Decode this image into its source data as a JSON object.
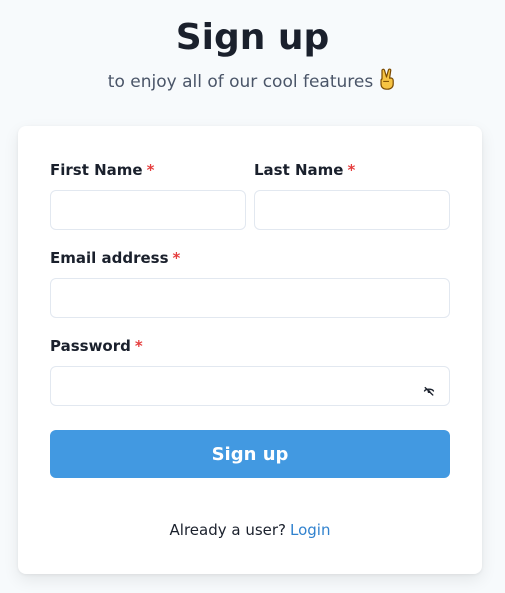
{
  "header": {
    "title": "Sign up",
    "subtitle": "to enjoy all of our cool features",
    "emoji": "✌️"
  },
  "form": {
    "required_marker": "*",
    "first_name": {
      "label": "First Name",
      "value": ""
    },
    "last_name": {
      "label": "Last Name",
      "value": ""
    },
    "email": {
      "label": "Email address",
      "value": ""
    },
    "password": {
      "label": "Password",
      "value": "",
      "toggle_icon": "eye-slash-icon"
    },
    "submit_label": "Sign up"
  },
  "footer": {
    "prompt": "Already a user?",
    "link_label": "Login"
  },
  "colors": {
    "background": "#f7fafc",
    "primary": "#4299e1",
    "link": "#3182ce",
    "required": "#e53e3e"
  }
}
